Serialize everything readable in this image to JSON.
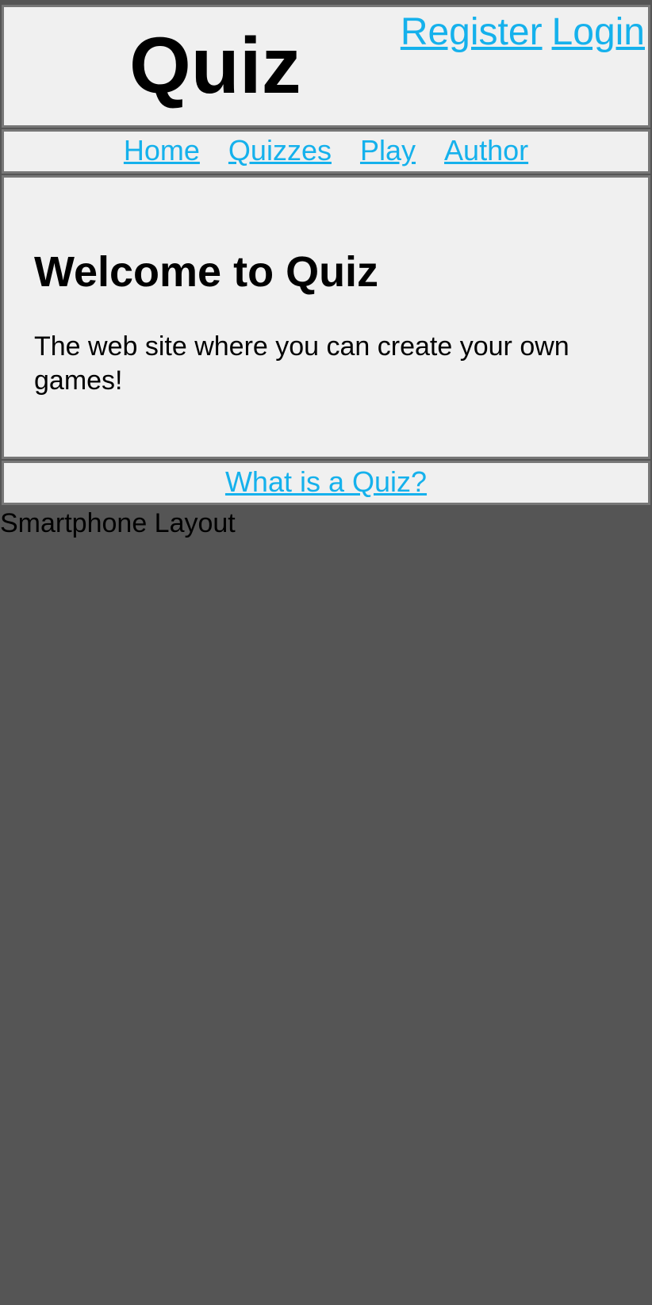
{
  "header": {
    "site_title": "Quiz",
    "register_label": "Register",
    "login_label": "Login"
  },
  "nav": {
    "items": [
      {
        "label": "Home"
      },
      {
        "label": "Quizzes"
      },
      {
        "label": "Play"
      },
      {
        "label": "Author"
      }
    ]
  },
  "main": {
    "heading": "Welcome to Quiz",
    "tagline": "The web site where you can create your own games!"
  },
  "footer": {
    "link_label": "What is a Quiz?"
  },
  "layout_label": "Smartphone Layout",
  "colors": {
    "background": "#555555",
    "panel": "#f0f0f0",
    "link": "#15b1ec",
    "border": "#777777"
  }
}
